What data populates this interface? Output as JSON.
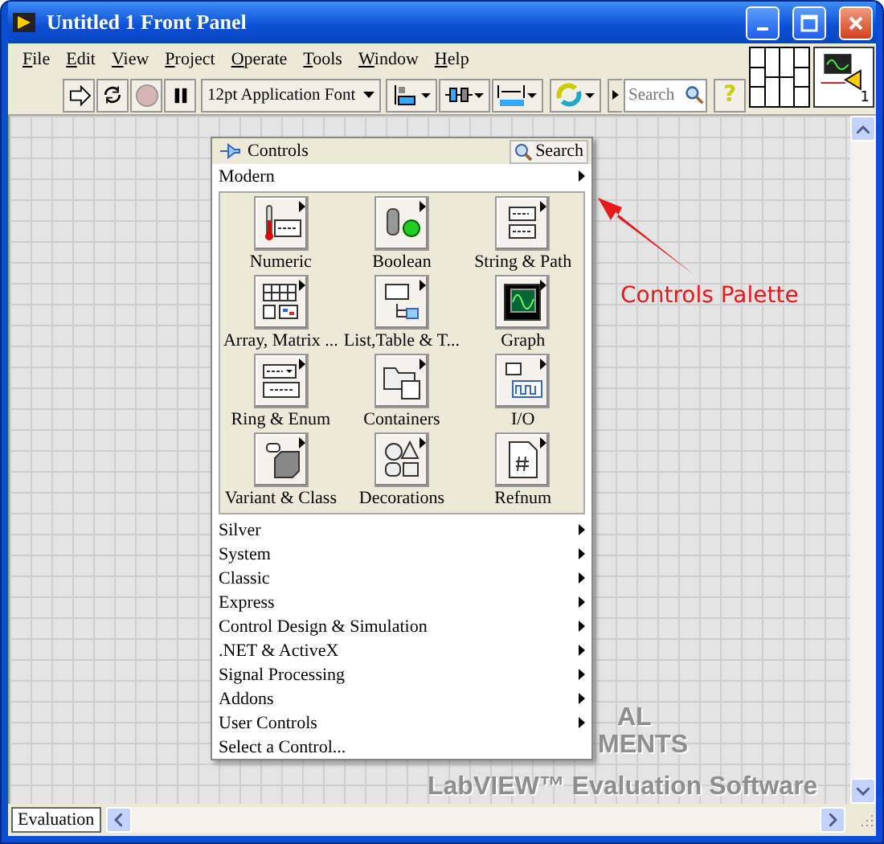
{
  "window": {
    "title": "Untitled 1 Front Panel"
  },
  "menu": [
    "File",
    "Edit",
    "View",
    "Project",
    "Operate",
    "Tools",
    "Window",
    "Help"
  ],
  "toolbar": {
    "font": "12pt Application Font",
    "search_placeholder": "Search",
    "abort_disabled": true,
    "help_label": "?"
  },
  "vi_icon": {
    "number": "1"
  },
  "palette": {
    "title": "Controls",
    "search_button": "Search",
    "categories": [
      {
        "label": "Modern",
        "kind": "submenu",
        "items": [
          {
            "label": "Numeric",
            "kind": "numeric"
          },
          {
            "label": "Boolean",
            "kind": "boolean"
          },
          {
            "label": "String & Path",
            "kind": "string"
          },
          {
            "label": "Array, Matrix ...",
            "kind": "array"
          },
          {
            "label": "List,Table & T...",
            "kind": "list"
          },
          {
            "label": "Graph",
            "kind": "graph"
          },
          {
            "label": "Ring & Enum",
            "kind": "ring"
          },
          {
            "label": "Containers",
            "kind": "containers"
          },
          {
            "label": "I/O",
            "kind": "io"
          },
          {
            "label": "Variant & Class",
            "kind": "variant"
          },
          {
            "label": "Decorations",
            "kind": "decorations"
          },
          {
            "label": "Refnum",
            "kind": "refnum"
          }
        ]
      },
      {
        "label": "Silver",
        "kind": "submenu"
      },
      {
        "label": "System",
        "kind": "submenu"
      },
      {
        "label": "Classic",
        "kind": "submenu"
      },
      {
        "label": "Express",
        "kind": "submenu"
      },
      {
        "label": "Control Design & Simulation",
        "kind": "submenu"
      },
      {
        "label": ".NET & ActiveX",
        "kind": "submenu"
      },
      {
        "label": "Signal Processing",
        "kind": "submenu"
      },
      {
        "label": "Addons",
        "kind": "submenu"
      },
      {
        "label": "User Controls",
        "kind": "submenu"
      },
      {
        "label": "Select a Control...",
        "kind": "action"
      }
    ]
  },
  "canvas": {
    "watermark": [
      "AL",
      "MENTS",
      "LabVIEW™ Evaluation Software"
    ],
    "annotation": "Controls Palette"
  },
  "status_bar": {
    "label": "Evaluation"
  }
}
